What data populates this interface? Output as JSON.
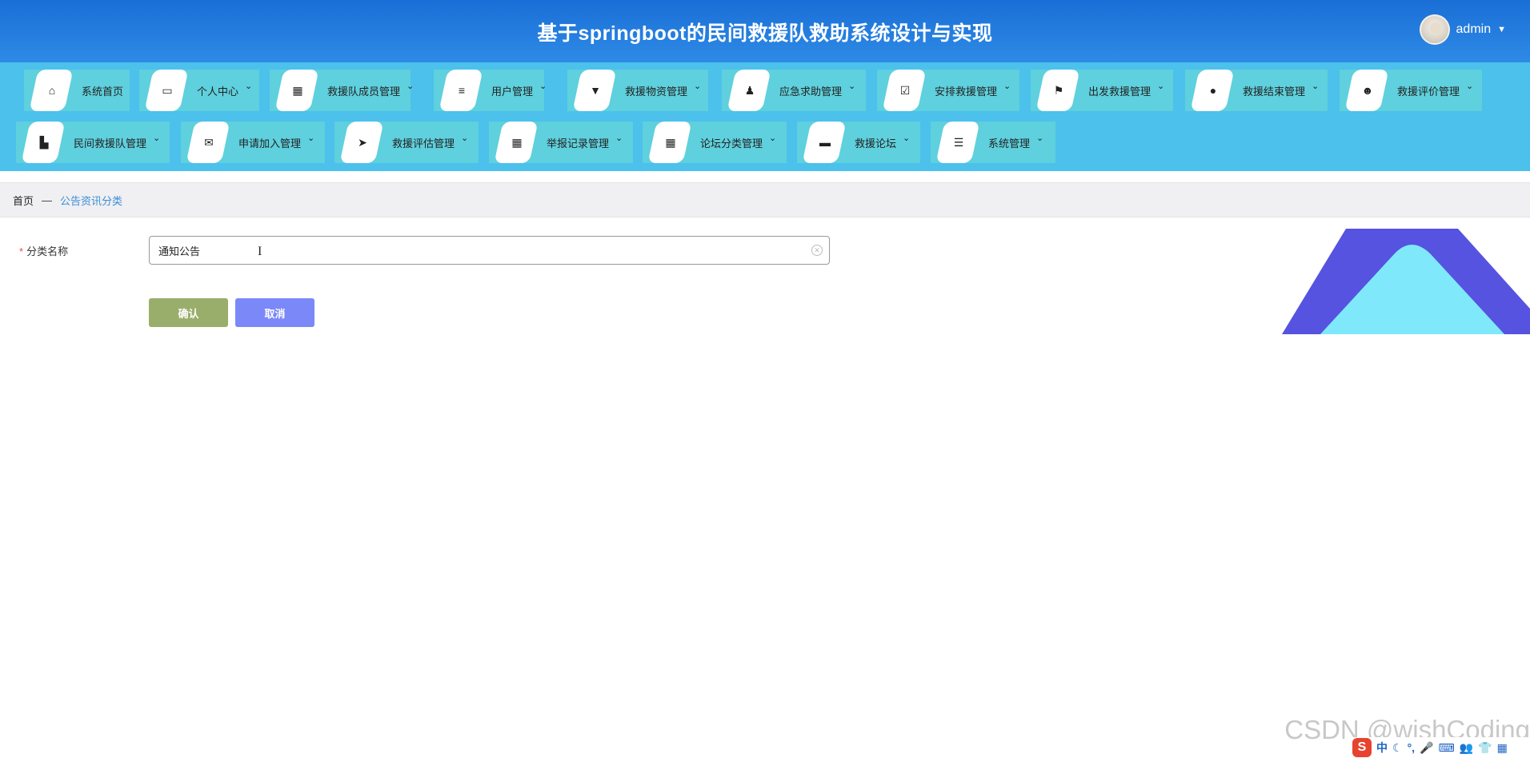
{
  "header": {
    "title": "基于springboot的民间救援队救助系统设计与实现",
    "username": "admin",
    "avatar_icon": "avatar-icon",
    "dropdown_icon": "caret-down-icon"
  },
  "nav": {
    "items": [
      {
        "label": "系统首页",
        "icon": "home-icon",
        "glyph": "⌂",
        "has_dropdown": false
      },
      {
        "label": "个人中心",
        "icon": "card-icon",
        "glyph": "▭",
        "has_dropdown": true
      },
      {
        "label": "救援队成员管理",
        "icon": "grid-icon",
        "glyph": "▦",
        "has_dropdown": true
      },
      {
        "label": "用户管理",
        "icon": "sliders-icon",
        "glyph": "≡",
        "has_dropdown": true
      },
      {
        "label": "救援物资管理",
        "icon": "brush-icon",
        "glyph": "▼",
        "has_dropdown": true
      },
      {
        "label": "应急求助管理",
        "icon": "stamp-icon",
        "glyph": "♟",
        "has_dropdown": true
      },
      {
        "label": "安排救援管理",
        "icon": "clipboard-check-icon",
        "glyph": "☑",
        "has_dropdown": true
      },
      {
        "label": "出发救援管理",
        "icon": "flag-icon",
        "glyph": "⚑",
        "has_dropdown": true
      },
      {
        "label": "救援结束管理",
        "icon": "map-pin-icon",
        "glyph": "●",
        "has_dropdown": true
      },
      {
        "label": "救援评价管理",
        "icon": "user-icon",
        "glyph": "☻",
        "has_dropdown": true
      },
      {
        "label": "民间救援队管理",
        "icon": "building-icon",
        "glyph": "▙",
        "has_dropdown": true
      },
      {
        "label": "申请加入管理",
        "icon": "mailbox-icon",
        "glyph": "✉",
        "has_dropdown": true
      },
      {
        "label": "救援评估管理",
        "icon": "send-icon",
        "glyph": "➤",
        "has_dropdown": true
      },
      {
        "label": "举报记录管理",
        "icon": "grid-icon",
        "glyph": "▦",
        "has_dropdown": true
      },
      {
        "label": "论坛分类管理",
        "icon": "grid-icon",
        "glyph": "▦",
        "has_dropdown": true
      },
      {
        "label": "救援论坛",
        "icon": "chat-icon",
        "glyph": "▬",
        "has_dropdown": true
      },
      {
        "label": "系统管理",
        "icon": "list-icon",
        "glyph": "☰",
        "has_dropdown": true
      }
    ]
  },
  "breadcrumb": {
    "home": "首页",
    "separator": "—",
    "current": "公告资讯分类"
  },
  "form": {
    "category_label": "分类名称",
    "required_mark": "*",
    "category_value": "通知公告",
    "confirm_label": "确认",
    "cancel_label": "取消"
  },
  "watermark": "CSDN @wishCoding",
  "tray": {
    "ime_label": "中",
    "glyphs": [
      "☾",
      "°,",
      "🎤",
      "⌨",
      "👥",
      "👕",
      "▦"
    ]
  },
  "colors": {
    "header_bg": "#1a6fd6",
    "nav_bg": "#4cc1ec",
    "nav_item_bg": "#5fd0dd",
    "confirm_bg": "#9aae6b",
    "cancel_bg": "#7a89f7",
    "breadcrumb_current": "#3a8fd8"
  }
}
